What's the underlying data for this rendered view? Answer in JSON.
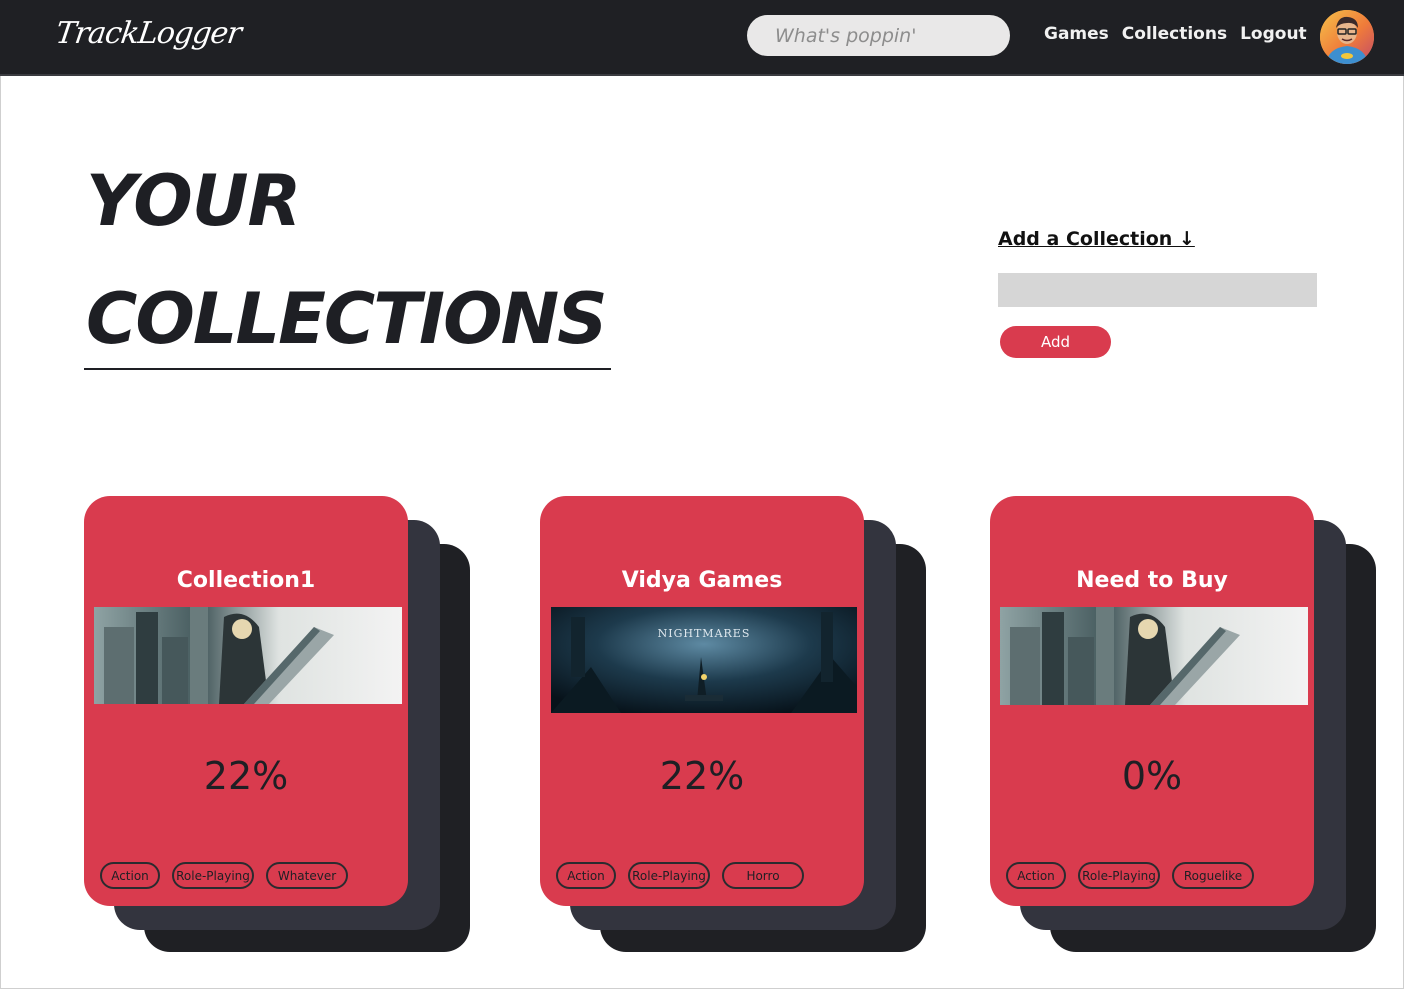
{
  "navbar": {
    "logo": "TrackLogger",
    "search_placeholder": "What's poppin'",
    "links": [
      "Games",
      "Collections",
      "Logout"
    ]
  },
  "page": {
    "heading_line1": "YOUR",
    "heading_line2": "COLLECTIONS"
  },
  "add_collection": {
    "title": "Add a Collection ↓",
    "input_value": "",
    "button_label": "Add"
  },
  "collections": [
    {
      "title": "Collection1",
      "percent": "22%",
      "image": "final-fantasy-vii-remake-banner",
      "tags": [
        "Action",
        "Role-Playing",
        "Whatever"
      ]
    },
    {
      "title": "Vidya Games",
      "percent": "22%",
      "image": "little-nightmares-ii-banner",
      "image_text": "NIGHTMARES",
      "tags": [
        "Action",
        "Role-Playing",
        "Horro"
      ]
    },
    {
      "title": "Need to Buy",
      "percent": "0%",
      "image": "final-fantasy-vii-remake-banner",
      "tags": [
        "Action",
        "Role-Playing",
        "Roguelike"
      ]
    }
  ],
  "colors": {
    "navbar": "#1f2024",
    "accent_red": "#d93b4e",
    "card_back_mid": "#33343e",
    "card_back_dark": "#1f2024",
    "text_dark": "#1e1f24"
  }
}
